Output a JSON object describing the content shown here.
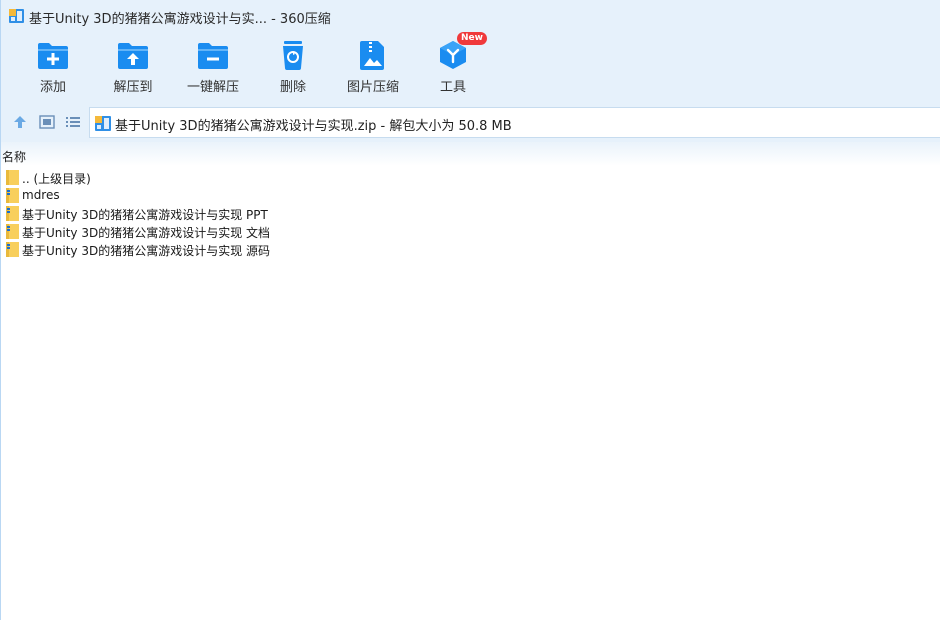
{
  "window": {
    "title": "基于Unity 3D的猪猪公寓游戏设计与实... - 360压缩",
    "app_icon": "archive-icon"
  },
  "toolbar": {
    "items": [
      {
        "label": "添加",
        "icon": "folder-add-icon"
      },
      {
        "label": "解压到",
        "icon": "folder-extract-icon"
      },
      {
        "label": "一键解压",
        "icon": "folder-quick-extract-icon"
      },
      {
        "label": "删除",
        "icon": "trash-icon"
      },
      {
        "label": "图片压缩",
        "icon": "image-compress-icon"
      },
      {
        "label": "工具",
        "icon": "tools-icon",
        "badge": "New"
      }
    ]
  },
  "nav": {
    "up_icon": "arrow-up-icon",
    "view_icon": "view-thumbnail-icon",
    "list_icon": "view-list-icon"
  },
  "address": {
    "text": "基于Unity 3D的猪猪公寓游戏设计与实现.zip - 解包大小为 50.8 MB"
  },
  "columns": {
    "name": "名称"
  },
  "files": [
    {
      "name": ".. (上级目录)",
      "icon": "folder-icon"
    },
    {
      "name": "mdres",
      "icon": "folder-zip-icon"
    },
    {
      "name": "基于Unity 3D的猪猪公寓游戏设计与实现 PPT",
      "icon": "folder-zip-icon"
    },
    {
      "name": "基于Unity 3D的猪猪公寓游戏设计与实现 文档",
      "icon": "folder-zip-icon"
    },
    {
      "name": "基于Unity 3D的猪猪公寓游戏设计与实现 源码",
      "icon": "folder-zip-icon"
    }
  ],
  "colors": {
    "toolbar_bg": "#e6f1fb",
    "icon_blue": "#1a8cf0",
    "badge_red": "#f0393b",
    "folder_yellow": "#f8cf5c"
  }
}
